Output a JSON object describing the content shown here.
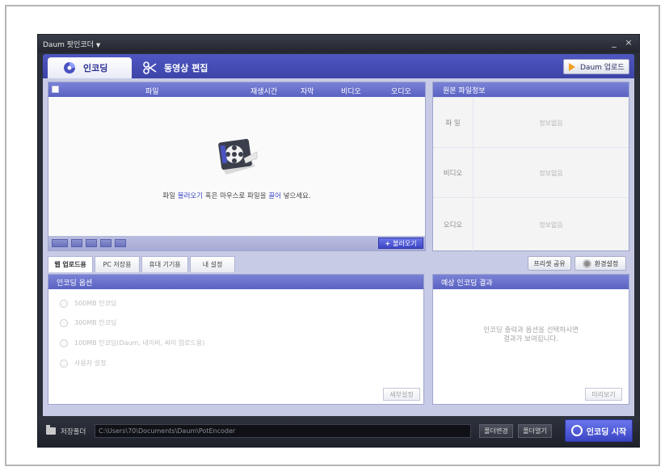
{
  "window": {
    "title": "Daum 팟인코더",
    "minimize": "_",
    "close": "×"
  },
  "tabs": {
    "encoding": "인코딩",
    "editing": "동영상 편집",
    "upload_button": "Daum 업로드"
  },
  "file_list": {
    "columns": [
      "파일",
      "재생시간",
      "자막",
      "비디오",
      "오디오"
    ],
    "drop_message_parts": [
      "파일 ",
      "불러오기",
      " 혹은 마우스로 파일을 ",
      "끌어",
      " 넣으세요."
    ],
    "open_button": "불러오기"
  },
  "source_info": {
    "header": "원본 파일정보",
    "rows": [
      {
        "label": "파 일",
        "value": "정보없음"
      },
      {
        "label": "비디오",
        "value": "정보없음"
      },
      {
        "label": "오디오",
        "value": "정보없음"
      }
    ]
  },
  "sub_tabs": [
    "웹 업로드용",
    "PC 저장용",
    "휴대 기기용",
    "내 설정"
  ],
  "preset_share": "프리셋 공유",
  "env_settings": "환경설정",
  "encoding_options": {
    "header": "인코딩 옵션",
    "options": [
      "500MB 인코딩",
      "300MB 인코딩",
      "100MB 인코딩(Daum, 네이버, 싸이 업로드용)",
      "사용자 설정"
    ],
    "detail_button": "세부설정"
  },
  "expected_result": {
    "header": "예상 인코딩 결과",
    "message": "인코딩 출력과 옵션을 선택하시면\n결과가 보여집니다.",
    "preview_button": "미리보기"
  },
  "bottom": {
    "save_folder_label": "저장폴더",
    "path": "C:\\Users\\70\\Documents\\Daum\\PotEncoder",
    "change_button": "폴더변경",
    "open_button": "폴더열기",
    "start_button": "인코딩 시작"
  },
  "colors": {
    "accent": "#4a52c0",
    "header_bg": "#5a62c2",
    "body_bg": "#c7cbe6",
    "dark_bar": "#2b2f3a"
  }
}
